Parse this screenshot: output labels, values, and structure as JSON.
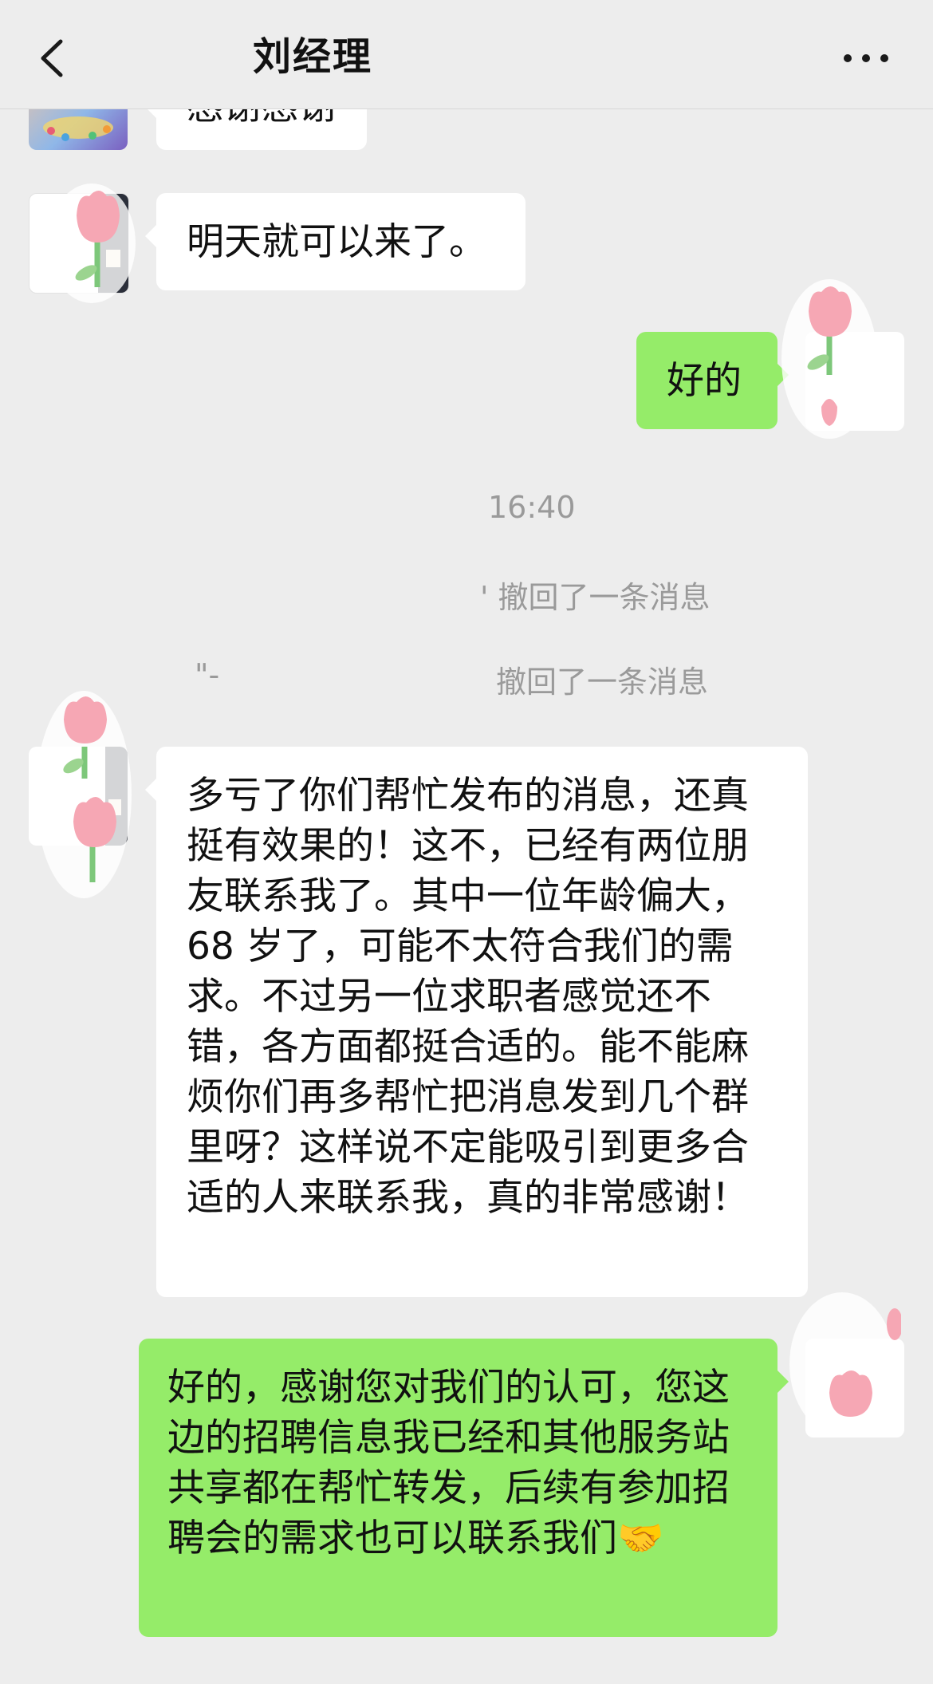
{
  "header": {
    "title": "刘经理",
    "back_icon": "chevron-left-icon",
    "more_icon": "more-dots-icon"
  },
  "messages": [
    {
      "side": "left",
      "text": "感谢感谢"
    },
    {
      "side": "left",
      "text": "明天就可以来了。"
    },
    {
      "side": "right",
      "text": "好的"
    },
    {
      "side": "left",
      "text": "多亏了你们帮忙发布的消息，还真挺有效果的！这不，已经有两位朋友联系我了。其中一位年龄偏大，68 岁了，可能不太符合我们的需求。不过另一位求职者感觉还不错，各方面都挺合适的。能不能麻烦你们再多帮忙把消息发到几个群里呀？这样说不定能吸引到更多合适的人来联系我，真的非常感谢！"
    },
    {
      "side": "right",
      "text": "好的，感谢您对我们的认可，您这边的招聘信息我已经和其他服务站共享都在帮忙转发，后续有参加招聘会的需求也可以联系我们🤝"
    }
  ],
  "system": {
    "timestamp": "16:40",
    "recall_1": "' 撤回了一条消息",
    "recall_2": "撤回了一条消息",
    "recall_2_prefix": "\"-"
  },
  "colors": {
    "background": "#ededed",
    "sent_bubble": "#95ec69",
    "received_bubble": "#ffffff",
    "system_text": "#9a9a9a"
  }
}
